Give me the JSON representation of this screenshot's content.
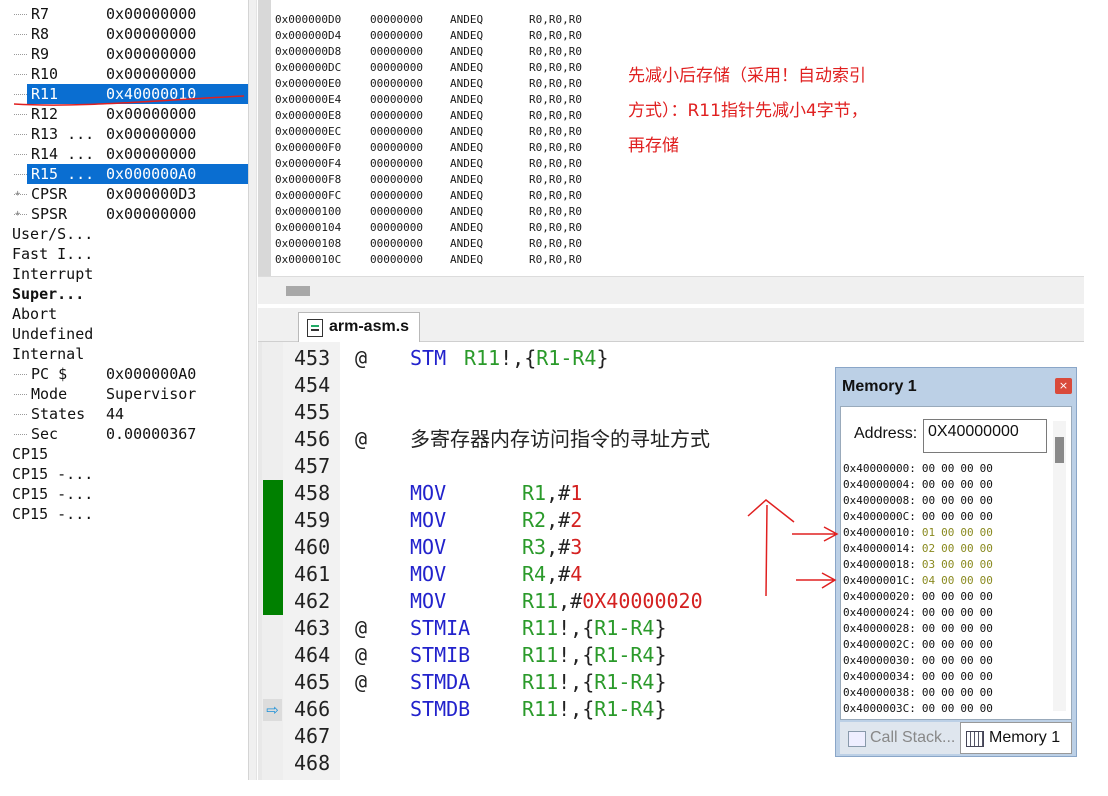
{
  "registers": {
    "rows": [
      {
        "name": "R7",
        "value": "0x00000000"
      },
      {
        "name": "R8",
        "value": "0x00000000"
      },
      {
        "name": "R9",
        "value": "0x00000000"
      },
      {
        "name": "R10",
        "value": "0x00000000"
      },
      {
        "name": "R11",
        "value": "0x40000010"
      },
      {
        "name": "R12",
        "value": "0x00000000"
      },
      {
        "name": "R13 ...",
        "value": "0x00000000"
      },
      {
        "name": "R14 ...",
        "value": "0x00000000"
      },
      {
        "name": "R15 ...",
        "value": "0x000000A0"
      },
      {
        "name": "CPSR",
        "value": "0x000000D3"
      },
      {
        "name": "SPSR",
        "value": "0x00000000"
      },
      {
        "name": "User/S...",
        "value": ""
      },
      {
        "name": "Fast I...",
        "value": ""
      },
      {
        "name": "Interrupt",
        "value": ""
      },
      {
        "name": "Super...",
        "value": ""
      },
      {
        "name": "Abort",
        "value": ""
      },
      {
        "name": "Undefined",
        "value": ""
      },
      {
        "name": "Internal",
        "value": ""
      },
      {
        "name": "PC  $",
        "value": "0x000000A0"
      },
      {
        "name": "Mode",
        "value": "Supervisor"
      },
      {
        "name": "States",
        "value": "44"
      },
      {
        "name": "Sec",
        "value": "0.00000367"
      },
      {
        "name": "CP15",
        "value": ""
      },
      {
        "name": "CP15 -...",
        "value": ""
      },
      {
        "name": "CP15 -...",
        "value": ""
      },
      {
        "name": "CP15 -...",
        "value": ""
      }
    ]
  },
  "disassembly": {
    "rows": [
      {
        "addr": "0x000000D0",
        "opcode": "00000000",
        "mnemonic": "ANDEQ",
        "operands": "R0,R0,R0"
      },
      {
        "addr": "0x000000D4",
        "opcode": "00000000",
        "mnemonic": "ANDEQ",
        "operands": "R0,R0,R0"
      },
      {
        "addr": "0x000000D8",
        "opcode": "00000000",
        "mnemonic": "ANDEQ",
        "operands": "R0,R0,R0"
      },
      {
        "addr": "0x000000DC",
        "opcode": "00000000",
        "mnemonic": "ANDEQ",
        "operands": "R0,R0,R0"
      },
      {
        "addr": "0x000000E0",
        "opcode": "00000000",
        "mnemonic": "ANDEQ",
        "operands": "R0,R0,R0"
      },
      {
        "addr": "0x000000E4",
        "opcode": "00000000",
        "mnemonic": "ANDEQ",
        "operands": "R0,R0,R0"
      },
      {
        "addr": "0x000000E8",
        "opcode": "00000000",
        "mnemonic": "ANDEQ",
        "operands": "R0,R0,R0"
      },
      {
        "addr": "0x000000EC",
        "opcode": "00000000",
        "mnemonic": "ANDEQ",
        "operands": "R0,R0,R0"
      },
      {
        "addr": "0x000000F0",
        "opcode": "00000000",
        "mnemonic": "ANDEQ",
        "operands": "R0,R0,R0"
      },
      {
        "addr": "0x000000F4",
        "opcode": "00000000",
        "mnemonic": "ANDEQ",
        "operands": "R0,R0,R0"
      },
      {
        "addr": "0x000000F8",
        "opcode": "00000000",
        "mnemonic": "ANDEQ",
        "operands": "R0,R0,R0"
      },
      {
        "addr": "0x000000FC",
        "opcode": "00000000",
        "mnemonic": "ANDEQ",
        "operands": "R0,R0,R0"
      },
      {
        "addr": "0x00000100",
        "opcode": "00000000",
        "mnemonic": "ANDEQ",
        "operands": "R0,R0,R0"
      },
      {
        "addr": "0x00000104",
        "opcode": "00000000",
        "mnemonic": "ANDEQ",
        "operands": "R0,R0,R0"
      },
      {
        "addr": "0x00000108",
        "opcode": "00000000",
        "mnemonic": "ANDEQ",
        "operands": "R0,R0,R0"
      },
      {
        "addr": "0x0000010C",
        "opcode": "00000000",
        "mnemonic": "ANDEQ",
        "operands": "R0,R0,R0"
      }
    ]
  },
  "annotation": {
    "lines": [
      "先减小后存储（采用！自动索引",
      "方式）：R11指针先减小4字节，",
      "再存储"
    ],
    "color": "#e02020"
  },
  "editor": {
    "tab_label": "arm-asm.s",
    "lines": [
      {
        "num": "453",
        "at": "@",
        "mnemonic": "STM",
        "dest": "R11",
        "sep": "!,{",
        "src": "R1-R4",
        "end": "}",
        "comment": ""
      },
      {
        "num": "454",
        "at": "",
        "mnemonic": "",
        "dest": "",
        "sep": "",
        "src": "",
        "end": "",
        "comment": ""
      },
      {
        "num": "455",
        "at": "",
        "mnemonic": "",
        "dest": "",
        "sep": "",
        "src": "",
        "end": "",
        "comment": ""
      },
      {
        "num": "456",
        "at": "@",
        "mnemonic": "",
        "dest": "",
        "sep": "",
        "src": "",
        "end": "",
        "comment": "多寄存器内存访问指令的寻址方式"
      },
      {
        "num": "457",
        "at": "",
        "mnemonic": "",
        "dest": "",
        "sep": "",
        "src": "",
        "end": "",
        "comment": ""
      },
      {
        "num": "458",
        "at": "",
        "mnemonic": "MOV",
        "dest": "R1",
        "sep": ",#",
        "src": "1",
        "end": "",
        "comment": ""
      },
      {
        "num": "459",
        "at": "",
        "mnemonic": "MOV",
        "dest": "R2",
        "sep": ",#",
        "src": "2",
        "end": "",
        "comment": ""
      },
      {
        "num": "460",
        "at": "",
        "mnemonic": "MOV",
        "dest": "R3",
        "sep": ",#",
        "src": "3",
        "end": "",
        "comment": ""
      },
      {
        "num": "461",
        "at": "",
        "mnemonic": "MOV",
        "dest": "R4",
        "sep": ",#",
        "src": "4",
        "end": "",
        "comment": ""
      },
      {
        "num": "462",
        "at": "",
        "mnemonic": "MOV",
        "dest": "R11",
        "sep": ",#",
        "src": "0X40000020",
        "end": "",
        "comment": ""
      },
      {
        "num": "463",
        "at": "@",
        "mnemonic": "STMIA",
        "dest": "R11",
        "sep": "!,{",
        "src": "R1-R4",
        "end": "}",
        "comment": ""
      },
      {
        "num": "464",
        "at": "@",
        "mnemonic": "STMIB",
        "dest": "R11",
        "sep": "!,{",
        "src": "R1-R4",
        "end": "}",
        "comment": ""
      },
      {
        "num": "465",
        "at": "@",
        "mnemonic": "STMDA",
        "dest": "R11",
        "sep": "!,{",
        "src": "R1-R4",
        "end": "}",
        "comment": ""
      },
      {
        "num": "466",
        "at": "",
        "mnemonic": "STMDB",
        "dest": "R11",
        "sep": "!,{",
        "src": "R1-R4",
        "end": "}",
        "comment": ""
      },
      {
        "num": "467",
        "at": "",
        "mnemonic": "",
        "dest": "",
        "sep": "",
        "src": "",
        "end": "",
        "comment": ""
      },
      {
        "num": "468",
        "at": "",
        "mnemonic": "",
        "dest": "",
        "sep": "",
        "src": "",
        "end": "",
        "comment": ""
      }
    ],
    "current_line_arrow": "⇨"
  },
  "memory": {
    "title": "Memory 1",
    "close_glyph": "×",
    "address_label": "Address:",
    "address_value": "0X40000000",
    "rows": [
      {
        "addr": "0x40000000:",
        "bytes": [
          "00",
          "00",
          "00",
          "00"
        ],
        "changed": false
      },
      {
        "addr": "0x40000004:",
        "bytes": [
          "00",
          "00",
          "00",
          "00"
        ],
        "changed": false
      },
      {
        "addr": "0x40000008:",
        "bytes": [
          "00",
          "00",
          "00",
          "00"
        ],
        "changed": false
      },
      {
        "addr": "0x4000000C:",
        "bytes": [
          "00",
          "00",
          "00",
          "00"
        ],
        "changed": false
      },
      {
        "addr": "0x40000010:",
        "bytes": [
          "01",
          "00",
          "00",
          "00"
        ],
        "changed": true
      },
      {
        "addr": "0x40000014:",
        "bytes": [
          "02",
          "00",
          "00",
          "00"
        ],
        "changed": true
      },
      {
        "addr": "0x40000018:",
        "bytes": [
          "03",
          "00",
          "00",
          "00"
        ],
        "changed": true
      },
      {
        "addr": "0x4000001C:",
        "bytes": [
          "04",
          "00",
          "00",
          "00"
        ],
        "changed": true
      },
      {
        "addr": "0x40000020:",
        "bytes": [
          "00",
          "00",
          "00",
          "00"
        ],
        "changed": false
      },
      {
        "addr": "0x40000024:",
        "bytes": [
          "00",
          "00",
          "00",
          "00"
        ],
        "changed": false
      },
      {
        "addr": "0x40000028:",
        "bytes": [
          "00",
          "00",
          "00",
          "00"
        ],
        "changed": false
      },
      {
        "addr": "0x4000002C:",
        "bytes": [
          "00",
          "00",
          "00",
          "00"
        ],
        "changed": false
      },
      {
        "addr": "0x40000030:",
        "bytes": [
          "00",
          "00",
          "00",
          "00"
        ],
        "changed": false
      },
      {
        "addr": "0x40000034:",
        "bytes": [
          "00",
          "00",
          "00",
          "00"
        ],
        "changed": false
      },
      {
        "addr": "0x40000038:",
        "bytes": [
          "00",
          "00",
          "00",
          "00"
        ],
        "changed": false
      },
      {
        "addr": "0x4000003C:",
        "bytes": [
          "00",
          "00",
          "00",
          "00"
        ],
        "changed": false
      }
    ],
    "tabs": {
      "call_stack": "Call Stack...",
      "memory": "Memory 1"
    }
  },
  "colors": {
    "selection": "#0a6ed1",
    "breakpoint_green": "#008000",
    "mnemonic_blue": "#2222cc",
    "register_green": "#2a9a2a",
    "immediate_red": "#d42020",
    "changed_byte": "#8a8a20"
  }
}
